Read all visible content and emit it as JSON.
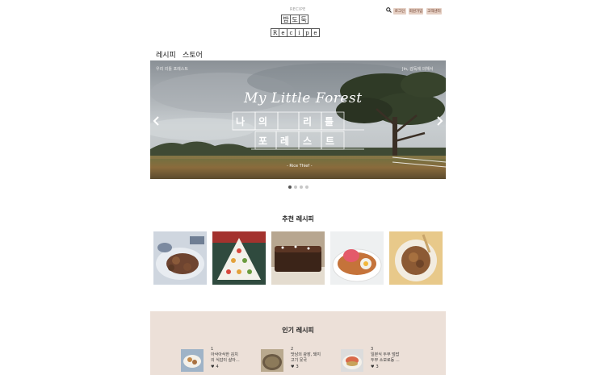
{
  "header": {
    "brand_small": "RECIPE",
    "logo_row1": [
      "밥",
      "도",
      "둑"
    ],
    "logo_row2": [
      "R",
      "e",
      "c",
      "i",
      "p",
      "e"
    ],
    "search_icon": "search-icon",
    "buttons": [
      "로그인",
      "회원가입",
      "고객센터"
    ]
  },
  "nav": {
    "tabs": [
      "레시피",
      "스토어"
    ]
  },
  "banner": {
    "top_left": "우리 리틀 포레스트",
    "top_right": "Jin, 감독에 의해서",
    "script_title": "My Little Forest",
    "title_row1": [
      "나",
      "의",
      "",
      "리",
      "틀"
    ],
    "title_row2": [
      "포",
      "레",
      "스",
      "트"
    ],
    "credit": "- Rice Thief -",
    "slide_count": 4,
    "active_slide": 0,
    "prev_icon": "chevron-left-icon",
    "next_icon": "chevron-right-icon"
  },
  "recommended": {
    "title": "추천 레시피",
    "items": [
      "food-1",
      "food-2",
      "food-3",
      "food-4",
      "food-5"
    ]
  },
  "popular": {
    "title": "인기 레시피",
    "items": [
      {
        "rank": "1",
        "title": "아삭아삭한 김치\n의 식감이 살아…",
        "likes": "4"
      },
      {
        "rank": "2",
        "title": "맛남의 광장, 돼지\n고기 뭇국",
        "likes": "3"
      },
      {
        "rank": "3",
        "title": "일본식 두부 덮밥\n두부 소보로동 …",
        "likes": "3"
      }
    ]
  },
  "colors": {
    "accent": "#e5cfc3",
    "popular_bg": "#ece0d8"
  }
}
